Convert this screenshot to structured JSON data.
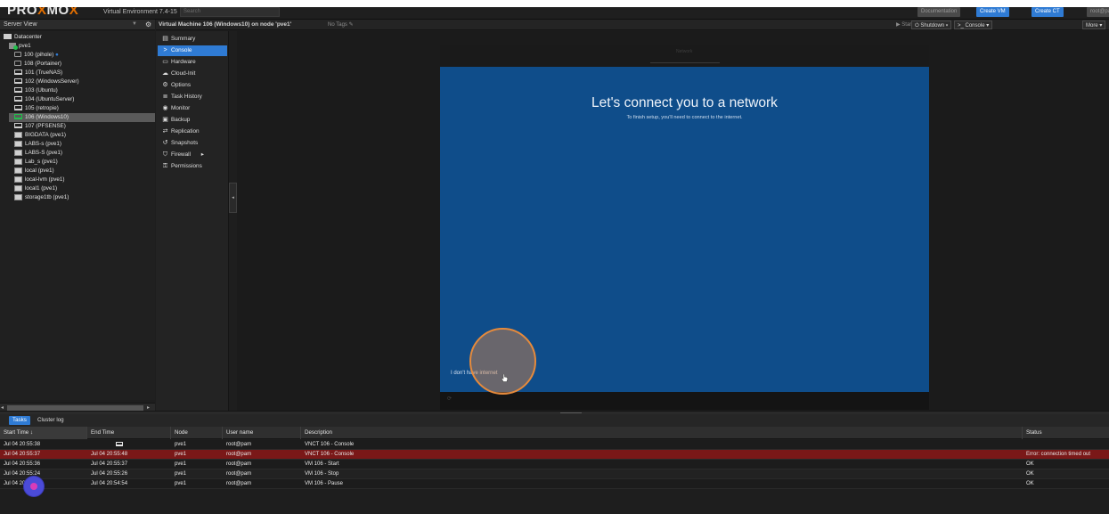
{
  "header": {
    "logo_left": "PRO",
    "logo_x1": "X",
    "logo_mid": "MO",
    "logo_x2": "X",
    "version": "Virtual Environment 7.4-15",
    "search_placeholder": "Search",
    "buttons": {
      "documentation": "Documentation",
      "create_vm": "Create VM",
      "create_ct": "Create CT",
      "user": "root@pam"
    }
  },
  "tree": {
    "view_label": "Server View",
    "items": [
      {
        "label": "Datacenter",
        "type": "datacenter"
      },
      {
        "label": "pve1",
        "type": "node"
      },
      {
        "label": "100 (pihole)",
        "type": "ct-running"
      },
      {
        "label": "108 (Portainer)",
        "type": "ct"
      },
      {
        "label": "101 (TrueNAS)",
        "type": "vm"
      },
      {
        "label": "102 (WindowsServer)",
        "type": "vm"
      },
      {
        "label": "103 (Ubuntu)",
        "type": "vm-off"
      },
      {
        "label": "104 (UbuntuServer)",
        "type": "vm-off"
      },
      {
        "label": "105 (retropie)",
        "type": "vm-off"
      },
      {
        "label": "106 (Windows10)",
        "type": "vm",
        "selected": true
      },
      {
        "label": "107 (PFSENSE)",
        "type": "vm-off"
      },
      {
        "label": "BIGDATA (pve1)",
        "type": "storage"
      },
      {
        "label": "LABS-s (pve1)",
        "type": "storage"
      },
      {
        "label": "LABS-S (pve1)",
        "type": "storage"
      },
      {
        "label": "Lab_s (pve1)",
        "type": "storage"
      },
      {
        "label": "local (pve1)",
        "type": "storage"
      },
      {
        "label": "local-lvm (pve1)",
        "type": "storage"
      },
      {
        "label": "local1 (pve1)",
        "type": "storage"
      },
      {
        "label": "storage1tb (pve1)",
        "type": "storage"
      }
    ]
  },
  "vm_header": {
    "title": "Virtual Machine 106 (Windows10) on node 'pve1'",
    "tags": "No Tags",
    "start": "Start",
    "shutdown": "Shutdown",
    "console": "Console",
    "more": "More"
  },
  "vm_menu": [
    {
      "label": "Summary",
      "icon": "book-icon"
    },
    {
      "label": "Console",
      "icon": "terminal-icon",
      "active": true
    },
    {
      "label": "Hardware",
      "icon": "desktop-icon"
    },
    {
      "label": "Cloud-Init",
      "icon": "cloud-icon"
    },
    {
      "label": "Options",
      "icon": "gear-icon"
    },
    {
      "label": "Task History",
      "icon": "list-icon"
    },
    {
      "label": "Monitor",
      "icon": "eye-icon"
    },
    {
      "label": "Backup",
      "icon": "floppy-icon"
    },
    {
      "label": "Replication",
      "icon": "retweet-icon"
    },
    {
      "label": "Snapshots",
      "icon": "history-icon"
    },
    {
      "label": "Firewall",
      "icon": "shield-icon",
      "has_submenu": true
    },
    {
      "label": "Permissions",
      "icon": "unlock-icon"
    }
  ],
  "console": {
    "tab": "Network",
    "heading": "Let's connect you to a network",
    "subtext": "To finish setup, you'll need to connect to the internet.",
    "no_internet_link": "I don't have internet"
  },
  "tasks": {
    "tabs": [
      "Tasks",
      "Cluster log"
    ],
    "columns": {
      "start": "Start Time ↓",
      "end": "End Time",
      "node": "Node",
      "user": "User name",
      "description": "Description",
      "status": "Status"
    },
    "rows": [
      {
        "start": "Jul 04 20:55:38",
        "end": "",
        "node": "pve1",
        "user": "root@pam",
        "description": "VNCT 106 - Console",
        "status": "",
        "kind": "running"
      },
      {
        "start": "Jul 04 20:55:37",
        "end": "Jul 04 20:55:48",
        "node": "pve1",
        "user": "root@pam",
        "description": "VNCT 106 - Console",
        "status": "Error: connection timed out",
        "kind": "error"
      },
      {
        "start": "Jul 04 20:55:36",
        "end": "Jul 04 20:55:37",
        "node": "pve1",
        "user": "root@pam",
        "description": "VM 106 - Start",
        "status": "OK",
        "kind": "ok"
      },
      {
        "start": "Jul 04 20:55:24",
        "end": "Jul 04 20:55:26",
        "node": "pve1",
        "user": "root@pam",
        "description": "VM 106 - Stop",
        "status": "OK",
        "kind": "ok"
      },
      {
        "start": "Jul 04 20:54:54",
        "end": "Jul 04 20:54:54",
        "node": "pve1",
        "user": "root@pam",
        "description": "VM 106 - Pause",
        "status": "OK",
        "kind": "ok"
      }
    ]
  },
  "colors": {
    "accent": "#2f7bd4",
    "console_bg": "#0f4d8a",
    "error_row": "#7a1818",
    "running": "#21bf4b",
    "logo_x": "#e57000"
  }
}
